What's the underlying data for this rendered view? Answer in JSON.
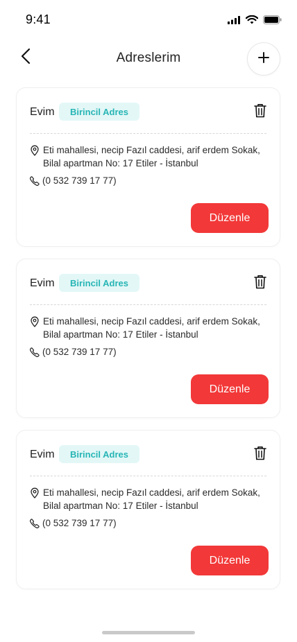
{
  "status_bar": {
    "time": "9:41",
    "icons": [
      "signal-icon",
      "wifi-icon",
      "battery-icon"
    ]
  },
  "header": {
    "title": "Adreslerim",
    "back_icon": "chevron-left-icon",
    "add_icon": "plus-icon"
  },
  "addresses": [
    {
      "name": "Evim",
      "badge": "Birincil Adres",
      "address": "Eti mahallesi, necip Fazıl caddesi, arif erdem Sokak, Bilal apartman No: 17 Etiler - İstanbul",
      "phone": "(0 532 739 17 77)",
      "edit_label": "Düzenle"
    },
    {
      "name": "Evim",
      "badge": "Birincil Adres",
      "address": "Eti mahallesi, necip Fazıl caddesi, arif erdem Sokak, Bilal apartman No: 17 Etiler - İstanbul",
      "phone": "(0 532 739 17 77)",
      "edit_label": "Düzenle"
    },
    {
      "name": "Evim",
      "badge": "Birincil Adres",
      "address": "Eti mahallesi, necip Fazıl caddesi, arif erdem Sokak, Bilal apartman No: 17 Etiler - İstanbul",
      "phone": "(0 532 739 17 77)",
      "edit_label": "Düzenle"
    }
  ],
  "colors": {
    "accent": "#F23838",
    "badge_bg": "#E3F7F7",
    "badge_text": "#27B5B5"
  }
}
